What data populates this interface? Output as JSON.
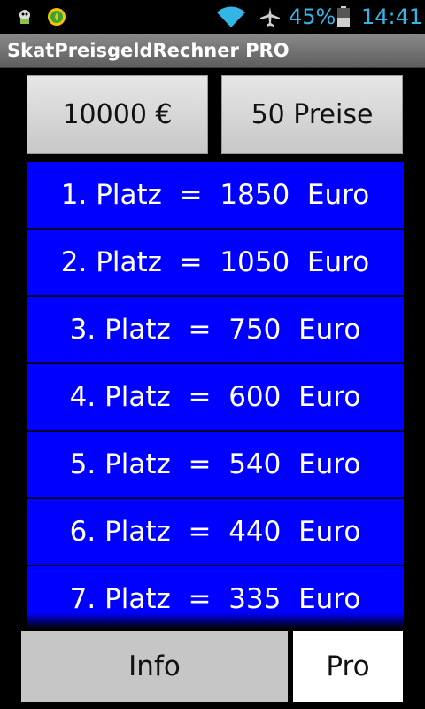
{
  "status_bar": {
    "battery_text": "45%",
    "time": "14:41",
    "accent_color": "#33b5e5",
    "icons": [
      "notification-app-icon",
      "notification-clover-icon",
      "wifi-icon",
      "airplane-mode-icon",
      "battery-icon"
    ]
  },
  "app": {
    "title": "SkatPreisgeldRechner PRO"
  },
  "controls": {
    "amount_label": "10000 €",
    "prizes_label": "50 Preise"
  },
  "prizes": [
    {
      "label": "1. Platz  =  1850  Euro"
    },
    {
      "label": "2. Platz  =  1050  Euro"
    },
    {
      "label": "3. Platz  =  750  Euro"
    },
    {
      "label": "4. Platz  =  600  Euro"
    },
    {
      "label": "5. Platz  =  540  Euro"
    },
    {
      "label": "6. Platz  =  440  Euro"
    },
    {
      "label": "7. Platz  =  335  Euro"
    }
  ],
  "footer": {
    "info_label": "Info",
    "pro_label": "Pro"
  },
  "colors": {
    "row_background": "#0000ff",
    "title_bar": "#6e6e6e",
    "button_gray": "#c6c6c6"
  }
}
